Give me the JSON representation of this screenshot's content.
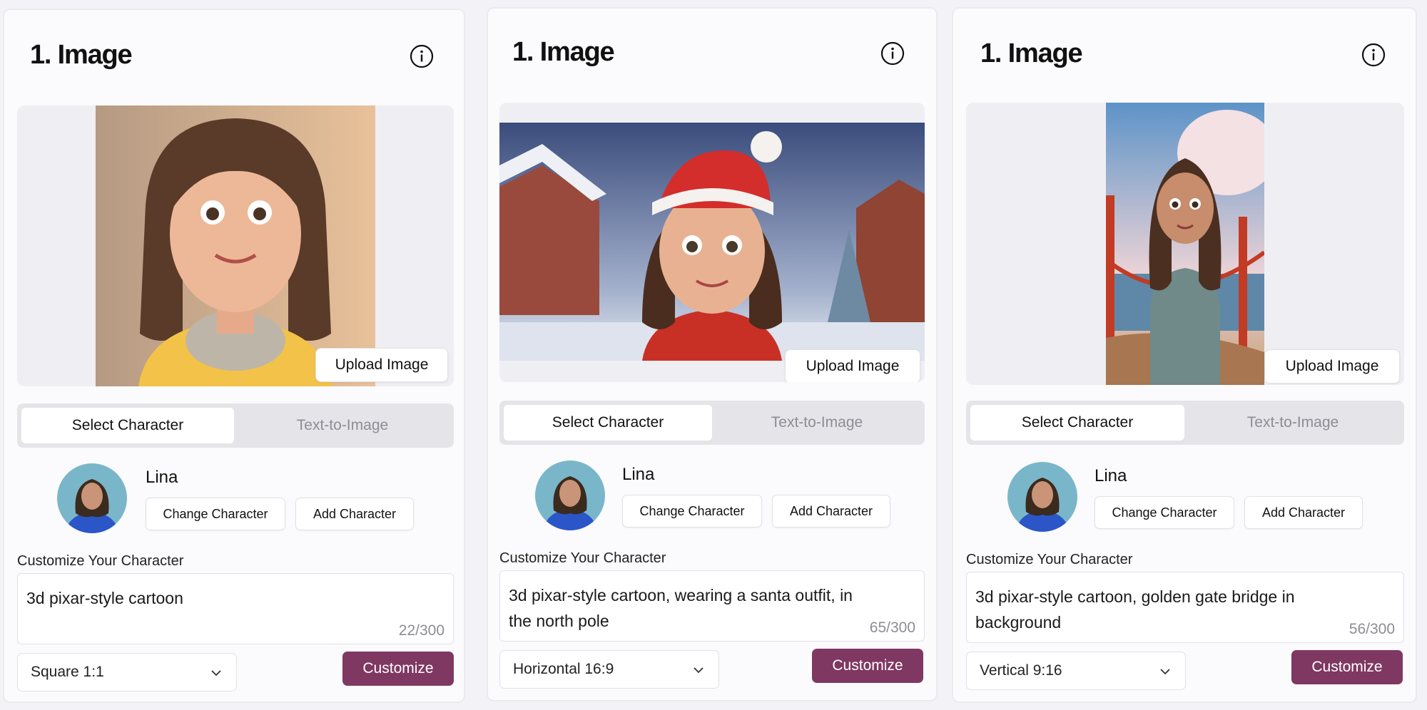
{
  "panels": [
    {
      "title": "1. Image",
      "upload_label": "Upload Image",
      "tabs": [
        "Select Character",
        "Text-to-Image"
      ],
      "character_name": "Lina",
      "change_label": "Change Character",
      "add_label": "Add Character",
      "customize_label": "Customize Your Character",
      "prompt_lines": [
        "3d pixar-style cartoon",
        ""
      ],
      "char_count": "22/300",
      "aspect_ratio": "Square 1:1",
      "customize_button": "Customize"
    },
    {
      "title": "1. Image",
      "upload_label": "Upload Image",
      "tabs": [
        "Select Character",
        "Text-to-Image"
      ],
      "character_name": "Lina",
      "change_label": "Change Character",
      "add_label": "Add Character",
      "customize_label": "Customize Your Character",
      "prompt_lines": [
        "3d pixar-style cartoon, wearing a santa outfit, in",
        "the north pole"
      ],
      "char_count": "65/300",
      "aspect_ratio": "Horizontal 16:9",
      "customize_button": "Customize"
    },
    {
      "title": "1. Image",
      "upload_label": "Upload Image",
      "tabs": [
        "Select Character",
        "Text-to-Image"
      ],
      "character_name": "Lina",
      "change_label": "Change Character",
      "add_label": "Add Character",
      "customize_label": "Customize Your Character",
      "prompt_lines": [
        "3d pixar-style cartoon, golden gate bridge in",
        "background"
      ],
      "char_count": "56/300",
      "aspect_ratio": "Vertical 9:16",
      "customize_button": "Customize"
    }
  ],
  "colors": {
    "accent": "#7f3862",
    "panel_bg": "#fbfafc",
    "tab_track": "#e5e4e8",
    "muted_text": "#8e8d94"
  },
  "icons": [
    "info-icon",
    "chevron-down-icon"
  ]
}
